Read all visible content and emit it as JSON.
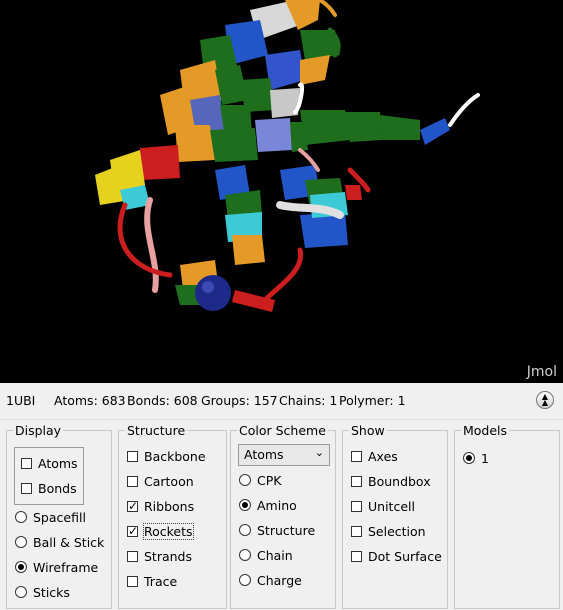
{
  "viewer": {
    "logo": "Jmol"
  },
  "info": {
    "model_id": "1UBI",
    "atoms": "Atoms: 683",
    "bonds": "Bonds: 608",
    "groups": "Groups: 157",
    "chains": "Chains: 1",
    "polymer": "Polymer: 1"
  },
  "display": {
    "title": "Display",
    "atoms": {
      "label": "Atoms",
      "checked": false
    },
    "bonds": {
      "label": "Bonds",
      "checked": false
    },
    "styles": [
      {
        "label": "Spacefill",
        "checked": false
      },
      {
        "label": "Ball & Stick",
        "checked": false
      },
      {
        "label": "Wireframe",
        "checked": true
      },
      {
        "label": "Sticks",
        "checked": false
      }
    ]
  },
  "structure": {
    "title": "Structure",
    "items": [
      {
        "label": "Backbone",
        "checked": false
      },
      {
        "label": "Cartoon",
        "checked": false
      },
      {
        "label": "Ribbons",
        "checked": true
      },
      {
        "label": "Rockets",
        "checked": true
      },
      {
        "label": "Strands",
        "checked": false
      },
      {
        "label": "Trace",
        "checked": false
      }
    ]
  },
  "color_scheme": {
    "title": "Color Scheme",
    "selected": "Atoms",
    "options": [
      {
        "label": "CPK",
        "checked": false
      },
      {
        "label": "Amino",
        "checked": true
      },
      {
        "label": "Structure",
        "checked": false
      },
      {
        "label": "Chain",
        "checked": false
      },
      {
        "label": "Charge",
        "checked": false
      }
    ]
  },
  "show": {
    "title": "Show",
    "items": [
      {
        "label": "Axes",
        "checked": false
      },
      {
        "label": "Boundbox",
        "checked": false
      },
      {
        "label": "Unitcell",
        "checked": false
      },
      {
        "label": "Selection",
        "checked": false
      },
      {
        "label": "Dot Surface",
        "checked": false
      }
    ]
  },
  "models": {
    "title": "Models",
    "items": [
      {
        "label": "1",
        "checked": true
      }
    ]
  }
}
